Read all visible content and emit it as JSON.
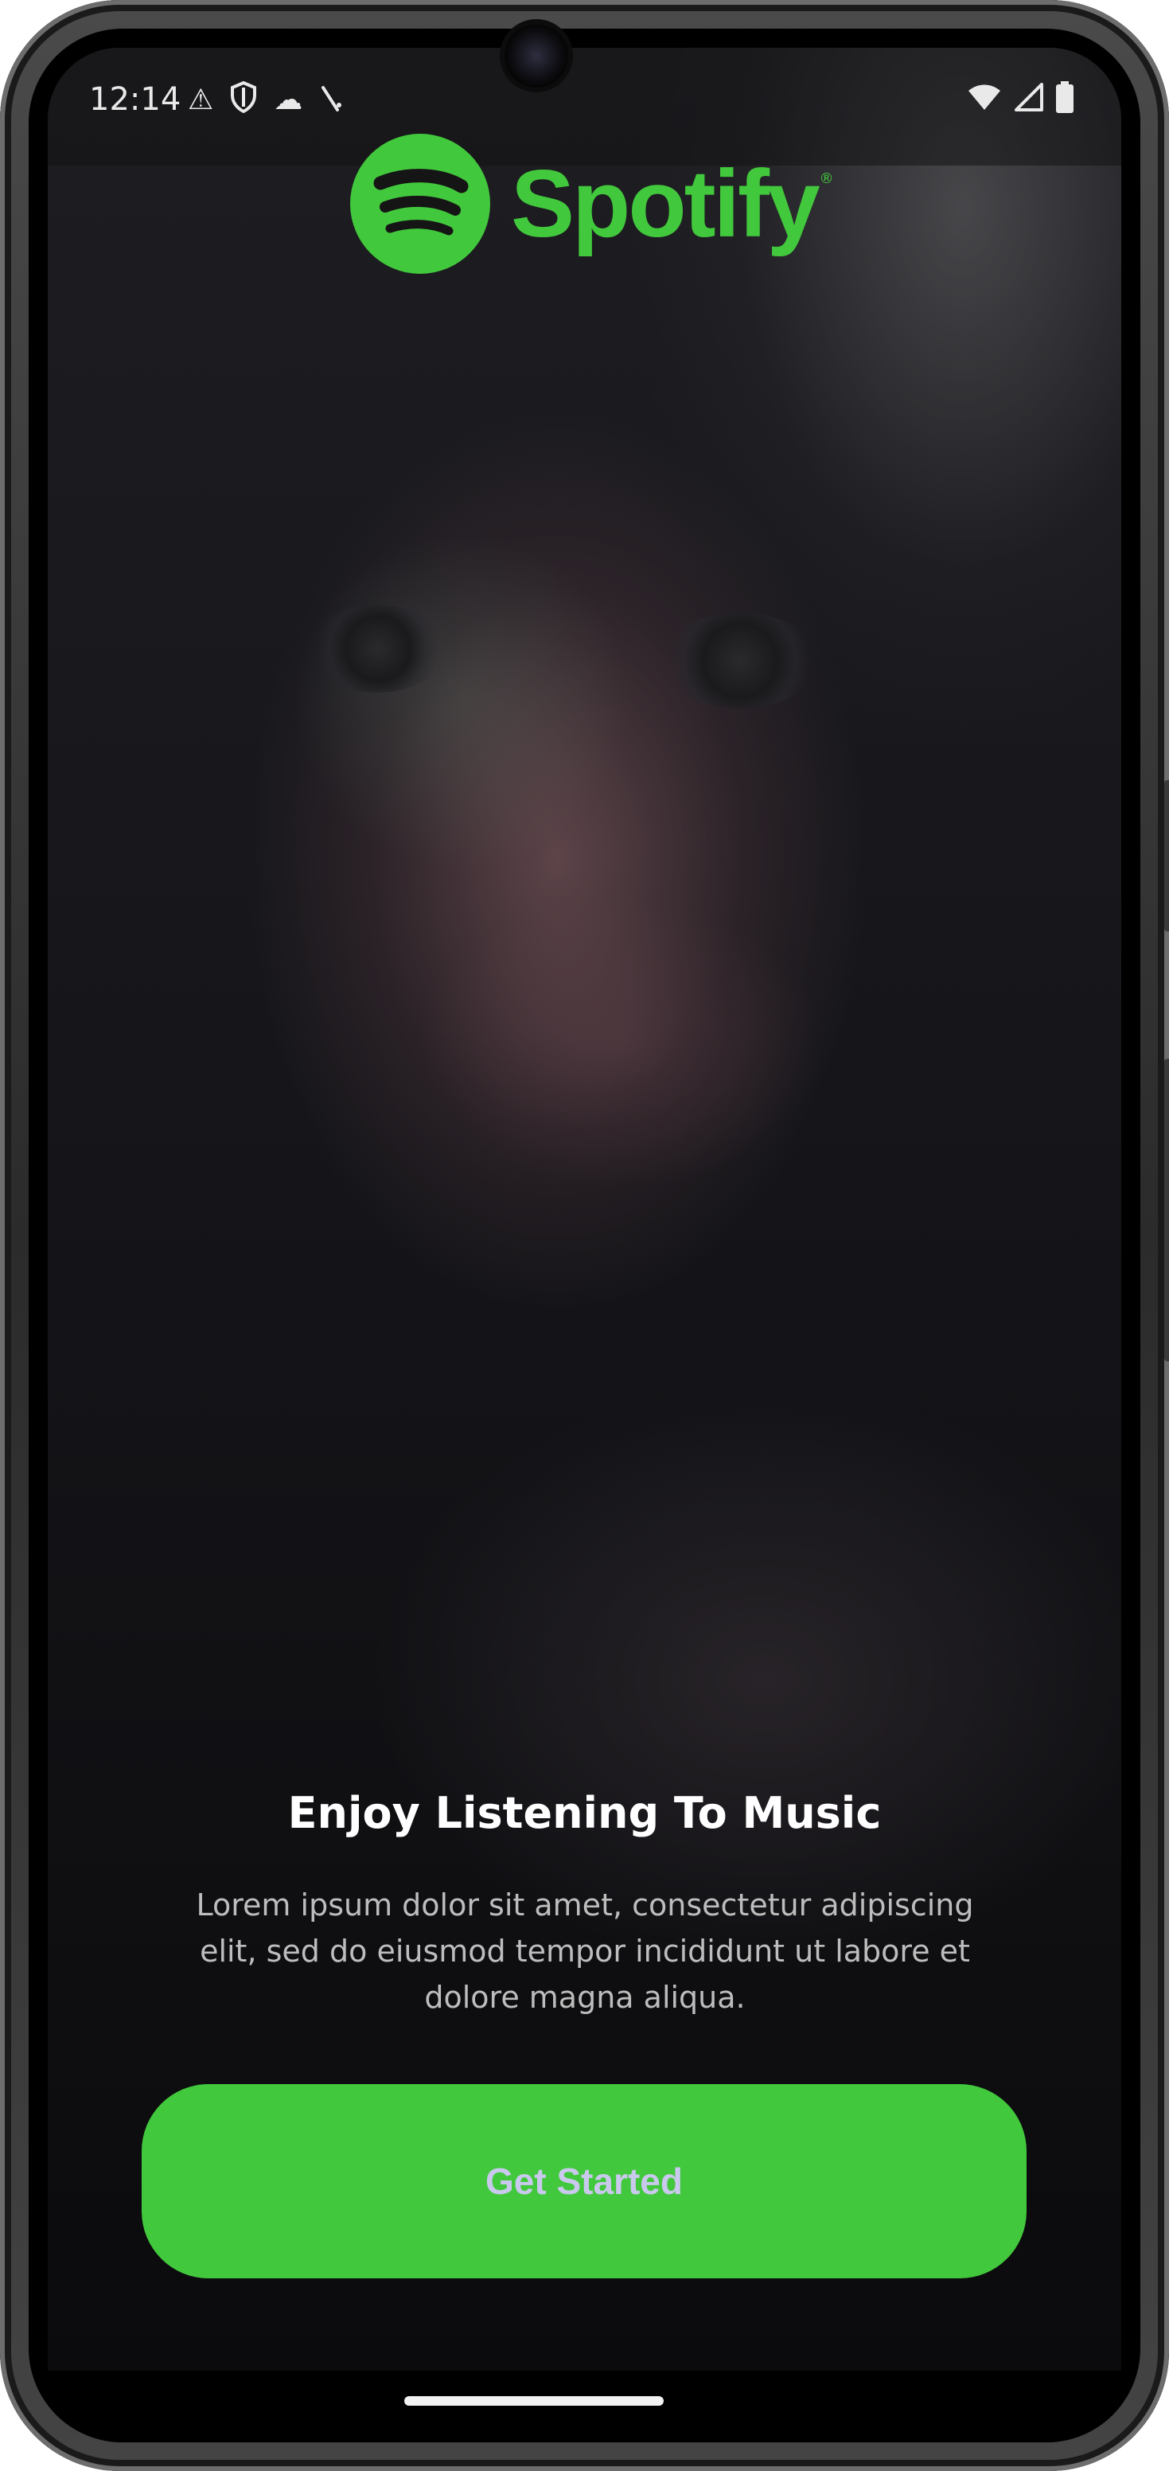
{
  "status_bar": {
    "time": "12:14",
    "left_icons": [
      "warning-icon",
      "shield-icon",
      "cloud-icon",
      "signal-strike-icon"
    ],
    "right_icons": [
      "wifi-icon",
      "cellular-icon",
      "battery-icon"
    ]
  },
  "brand": {
    "name": "Spotify",
    "registered_mark": "®",
    "color": "#42C83C"
  },
  "onboarding": {
    "title": "Enjoy Listening To Music",
    "description": "Lorem ipsum dolor sit amet, consectetur adipiscing elit, sed do eiusmod tempor incididunt ut labore et dolore magna aliqua.",
    "cta_label": "Get Started"
  },
  "colors": {
    "accent": "#42C83C",
    "cta_text": "#C9C9EE",
    "title_text": "#FFFFFF",
    "body_text": "#BDBDBD"
  }
}
